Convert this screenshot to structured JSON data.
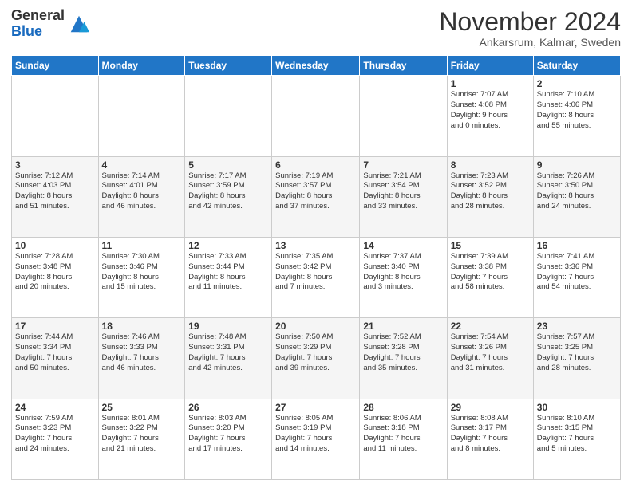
{
  "header": {
    "logo_general": "General",
    "logo_blue": "Blue",
    "title": "November 2024",
    "subtitle": "Ankarsrum, Kalmar, Sweden"
  },
  "weekdays": [
    "Sunday",
    "Monday",
    "Tuesday",
    "Wednesday",
    "Thursday",
    "Friday",
    "Saturday"
  ],
  "weeks": [
    [
      {
        "day": "",
        "info": ""
      },
      {
        "day": "",
        "info": ""
      },
      {
        "day": "",
        "info": ""
      },
      {
        "day": "",
        "info": ""
      },
      {
        "day": "",
        "info": ""
      },
      {
        "day": "1",
        "info": "Sunrise: 7:07 AM\nSunset: 4:08 PM\nDaylight: 9 hours\nand 0 minutes."
      },
      {
        "day": "2",
        "info": "Sunrise: 7:10 AM\nSunset: 4:06 PM\nDaylight: 8 hours\nand 55 minutes."
      }
    ],
    [
      {
        "day": "3",
        "info": "Sunrise: 7:12 AM\nSunset: 4:03 PM\nDaylight: 8 hours\nand 51 minutes."
      },
      {
        "day": "4",
        "info": "Sunrise: 7:14 AM\nSunset: 4:01 PM\nDaylight: 8 hours\nand 46 minutes."
      },
      {
        "day": "5",
        "info": "Sunrise: 7:17 AM\nSunset: 3:59 PM\nDaylight: 8 hours\nand 42 minutes."
      },
      {
        "day": "6",
        "info": "Sunrise: 7:19 AM\nSunset: 3:57 PM\nDaylight: 8 hours\nand 37 minutes."
      },
      {
        "day": "7",
        "info": "Sunrise: 7:21 AM\nSunset: 3:54 PM\nDaylight: 8 hours\nand 33 minutes."
      },
      {
        "day": "8",
        "info": "Sunrise: 7:23 AM\nSunset: 3:52 PM\nDaylight: 8 hours\nand 28 minutes."
      },
      {
        "day": "9",
        "info": "Sunrise: 7:26 AM\nSunset: 3:50 PM\nDaylight: 8 hours\nand 24 minutes."
      }
    ],
    [
      {
        "day": "10",
        "info": "Sunrise: 7:28 AM\nSunset: 3:48 PM\nDaylight: 8 hours\nand 20 minutes."
      },
      {
        "day": "11",
        "info": "Sunrise: 7:30 AM\nSunset: 3:46 PM\nDaylight: 8 hours\nand 15 minutes."
      },
      {
        "day": "12",
        "info": "Sunrise: 7:33 AM\nSunset: 3:44 PM\nDaylight: 8 hours\nand 11 minutes."
      },
      {
        "day": "13",
        "info": "Sunrise: 7:35 AM\nSunset: 3:42 PM\nDaylight: 8 hours\nand 7 minutes."
      },
      {
        "day": "14",
        "info": "Sunrise: 7:37 AM\nSunset: 3:40 PM\nDaylight: 8 hours\nand 3 minutes."
      },
      {
        "day": "15",
        "info": "Sunrise: 7:39 AM\nSunset: 3:38 PM\nDaylight: 7 hours\nand 58 minutes."
      },
      {
        "day": "16",
        "info": "Sunrise: 7:41 AM\nSunset: 3:36 PM\nDaylight: 7 hours\nand 54 minutes."
      }
    ],
    [
      {
        "day": "17",
        "info": "Sunrise: 7:44 AM\nSunset: 3:34 PM\nDaylight: 7 hours\nand 50 minutes."
      },
      {
        "day": "18",
        "info": "Sunrise: 7:46 AM\nSunset: 3:33 PM\nDaylight: 7 hours\nand 46 minutes."
      },
      {
        "day": "19",
        "info": "Sunrise: 7:48 AM\nSunset: 3:31 PM\nDaylight: 7 hours\nand 42 minutes."
      },
      {
        "day": "20",
        "info": "Sunrise: 7:50 AM\nSunset: 3:29 PM\nDaylight: 7 hours\nand 39 minutes."
      },
      {
        "day": "21",
        "info": "Sunrise: 7:52 AM\nSunset: 3:28 PM\nDaylight: 7 hours\nand 35 minutes."
      },
      {
        "day": "22",
        "info": "Sunrise: 7:54 AM\nSunset: 3:26 PM\nDaylight: 7 hours\nand 31 minutes."
      },
      {
        "day": "23",
        "info": "Sunrise: 7:57 AM\nSunset: 3:25 PM\nDaylight: 7 hours\nand 28 minutes."
      }
    ],
    [
      {
        "day": "24",
        "info": "Sunrise: 7:59 AM\nSunset: 3:23 PM\nDaylight: 7 hours\nand 24 minutes."
      },
      {
        "day": "25",
        "info": "Sunrise: 8:01 AM\nSunset: 3:22 PM\nDaylight: 7 hours\nand 21 minutes."
      },
      {
        "day": "26",
        "info": "Sunrise: 8:03 AM\nSunset: 3:20 PM\nDaylight: 7 hours\nand 17 minutes."
      },
      {
        "day": "27",
        "info": "Sunrise: 8:05 AM\nSunset: 3:19 PM\nDaylight: 7 hours\nand 14 minutes."
      },
      {
        "day": "28",
        "info": "Sunrise: 8:06 AM\nSunset: 3:18 PM\nDaylight: 7 hours\nand 11 minutes."
      },
      {
        "day": "29",
        "info": "Sunrise: 8:08 AM\nSunset: 3:17 PM\nDaylight: 7 hours\nand 8 minutes."
      },
      {
        "day": "30",
        "info": "Sunrise: 8:10 AM\nSunset: 3:15 PM\nDaylight: 7 hours\nand 5 minutes."
      }
    ]
  ]
}
